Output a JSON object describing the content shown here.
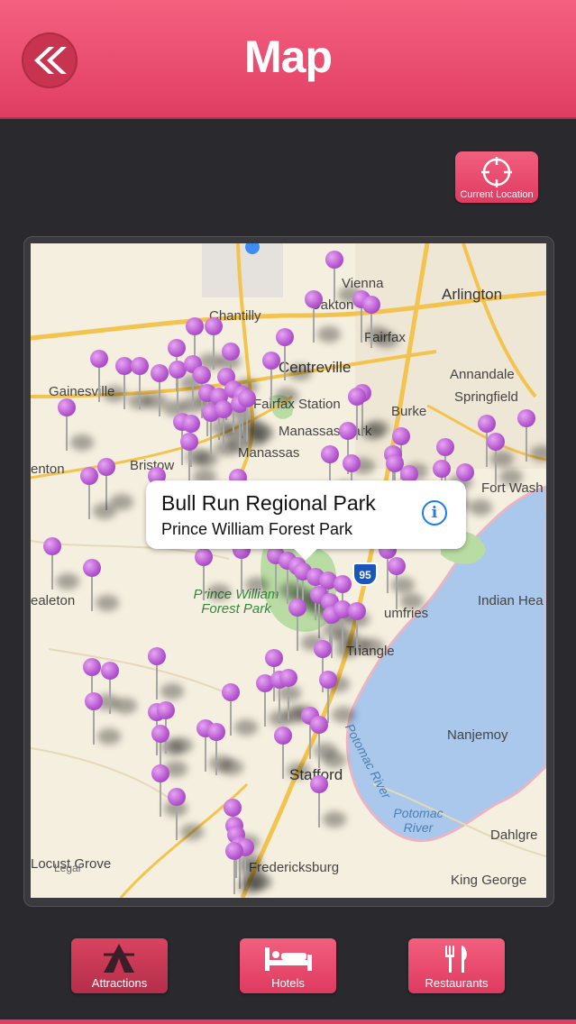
{
  "header": {
    "title": "Map"
  },
  "colors": {
    "accent": "#e8476c",
    "pin": "#b455cf",
    "background": "#2a2a2e"
  },
  "buttons": {
    "current_location": "Current Location"
  },
  "icons": {
    "back": "double-chevron-left-icon",
    "locate": "crosshair-icon"
  },
  "map": {
    "places": [
      "Vienna",
      "Oakton",
      "Arlington",
      "Chantilly",
      "Fairfax",
      "Centreville",
      "Annandale",
      "Gainesville",
      "Fairfax Station",
      "Springfield",
      "Manassas Park",
      "Burke",
      "Manassas",
      "Bristow",
      "enton",
      "Fort Wash",
      "ealeton",
      "Indian Hea",
      "umfries",
      "Triangle",
      "Nanjemoy",
      "Stafford",
      "Dahlgre",
      "Locust Grove",
      "Fredericksburg",
      "King George",
      "Legal"
    ],
    "parks": [
      "Prince William Forest Park"
    ],
    "water": [
      "Potomac River",
      "Potomac River"
    ],
    "highway": "95"
  },
  "callout": {
    "title": "Bull Run Regional Park",
    "subtitle": "Prince William Forest Park"
  },
  "tabs": [
    {
      "label": "Attractions",
      "icon": "tent-icon",
      "active": true
    },
    {
      "label": "Hotels",
      "icon": "bed-icon",
      "active": false
    },
    {
      "label": "Restaurants",
      "icon": "fork-knife-icon",
      "active": false
    }
  ]
}
